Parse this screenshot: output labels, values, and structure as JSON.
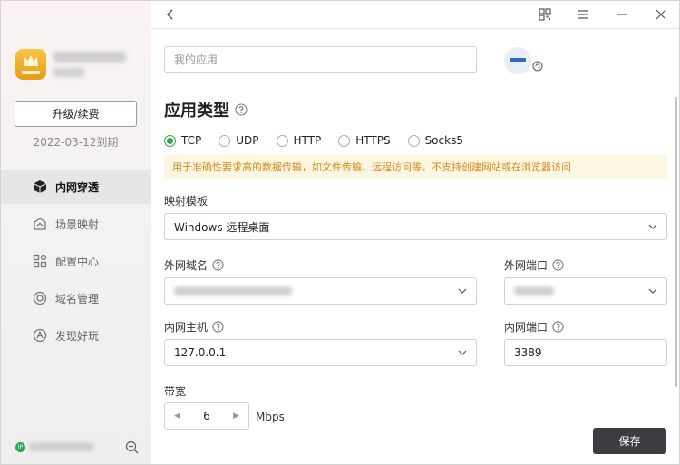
{
  "sidebar": {
    "upgrade_label": "升级/续费",
    "expire_text": "2022-03-12到期",
    "ip_badge": "IP",
    "items": [
      {
        "label": "内网穿透",
        "icon": "cube-icon",
        "active": true
      },
      {
        "label": "场景映射",
        "icon": "scene-icon",
        "active": false
      },
      {
        "label": "配置中心",
        "icon": "grid-icon",
        "active": false
      },
      {
        "label": "域名管理",
        "icon": "domain-icon",
        "active": false
      },
      {
        "label": "发现好玩",
        "icon": "discover-icon",
        "active": false
      }
    ]
  },
  "topbar": {
    "icons": [
      "back-icon",
      "qr-icon",
      "menu-icon",
      "minimize-icon",
      "close-icon"
    ]
  },
  "form": {
    "app_name_placeholder": "我的应用",
    "app_type_title": "应用类型",
    "protocols": [
      {
        "label": "TCP",
        "checked": true
      },
      {
        "label": "UDP",
        "checked": false
      },
      {
        "label": "HTTP",
        "checked": false
      },
      {
        "label": "HTTPS",
        "checked": false
      },
      {
        "label": "Socks5",
        "checked": false
      }
    ],
    "notice": "用于准确性要求高的数据传输，如文件传输、远程访问等。不支持创建网站或在浏览器访问",
    "template_label": "映射模板",
    "template_value": "Windows 远程桌面",
    "ext_domain_label": "外网域名",
    "ext_port_label": "外网端口",
    "int_host_label": "内网主机",
    "int_host_value": "127.0.0.1",
    "int_port_label": "内网端口",
    "int_port_value": "3389",
    "bandwidth_label": "带宽",
    "bandwidth_value": "6",
    "bandwidth_unit": "Mbps",
    "save_label": "保存"
  },
  "colors": {
    "accent_green": "#2fa44a",
    "notice_bg": "#fdf6e3",
    "notice_text": "#d58b17",
    "save_bg": "#3b3d42"
  }
}
